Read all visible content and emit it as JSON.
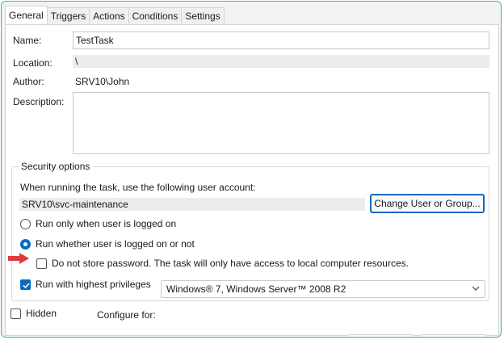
{
  "tabs": [
    "General",
    "Triggers",
    "Actions",
    "Conditions",
    "Settings"
  ],
  "general": {
    "name_label": "Name:",
    "name_value": "TestTask",
    "location_label": "Location:",
    "location_value": "\\",
    "author_label": "Author:",
    "author_value": "SRV10\\John",
    "description_label": "Description:",
    "description_value": ""
  },
  "security": {
    "title": "Security options",
    "account_prompt": "When running the task, use the following user account:",
    "account_value": "SRV10\\svc-maintenance",
    "change_button": "Change User or Group...",
    "radio_logged_on": "Run only when user is logged on",
    "radio_logged_on_selected": false,
    "radio_whether": "Run whether user is logged on or not",
    "radio_whether_selected": true,
    "do_not_store_label": "Do not store password.  The task will only have access to local computer resources.",
    "do_not_store_checked": false,
    "highest_privileges_label": "Run with highest privileges",
    "highest_privileges_checked": true
  },
  "footer": {
    "hidden_label": "Hidden",
    "hidden_checked": false,
    "configure_label": "Configure for:",
    "configure_value": "Windows® 7, Windows Server™ 2008 R2"
  },
  "colors": {
    "accent": "#0a6bc4",
    "frame_border": "#3cc47c",
    "arrow": "#e0393e"
  },
  "icons": [
    "red-arrow-icon",
    "chevron-down-icon",
    "checkmark-icon"
  ]
}
